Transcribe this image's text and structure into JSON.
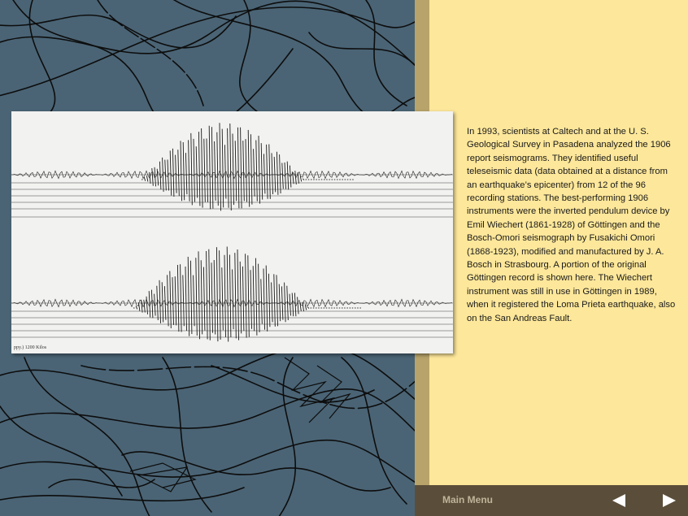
{
  "description": "In 1993, scientists at Caltech and at the U. S. Geological Survey in Pasadena analyzed the 1906 report seismograms. They identified useful teleseismic data (data obtained at a distance from an earthquake’s epicenter) from 12 of the 96 recording stations. The best-performing 1906 instruments were the inverted pendulum device by Emil Wiechert (1861-1928) of Göttingen and the Bosch-Omori seismograph by Fusakichi Omori (1868-1923), modified and manufactured by J. A. Bosch in Strasbourg. A portion of the original Göttingen record is shown here. The Wiechert instrument was still in use in Göttingen in 1989, when it registered the Loma Prieta earthquake, also on the San Andreas Fault.",
  "seismogram": {
    "caption": "ppy.)   1200 Kilos"
  },
  "nav": {
    "main_menu_label": "Main Menu",
    "prev_icon": "triangle-left-icon",
    "next_icon": "triangle-right-icon"
  },
  "colors": {
    "left_background": "#4a6475",
    "right_background": "#fde79a",
    "divider": "#b8a46a",
    "bottom_bar": "#5a4e3a",
    "nav_text": "#bfb49a",
    "nav_arrow": "#ffffff"
  }
}
